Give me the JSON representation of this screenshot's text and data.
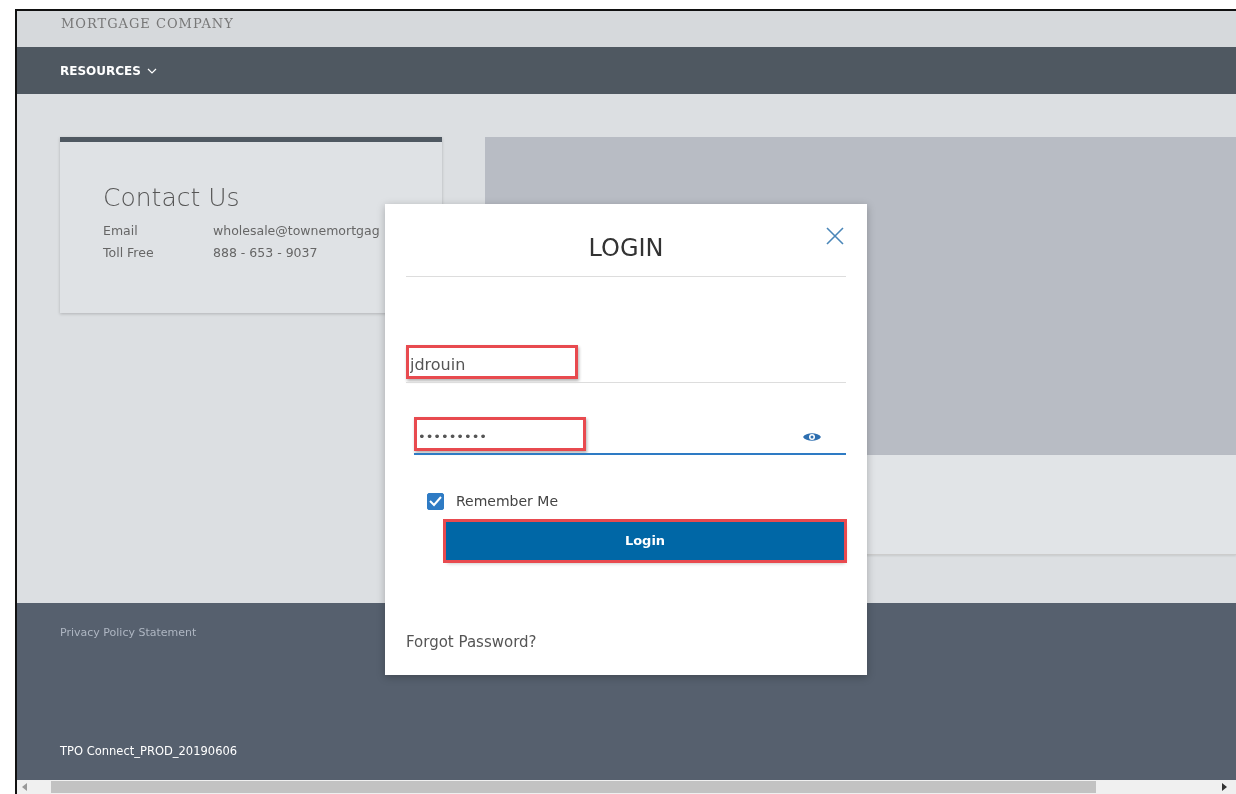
{
  "header": {
    "logo_text": "MORTGAGE COMPANY"
  },
  "nav": {
    "items": [
      {
        "label": "RESOURCES",
        "has_dropdown": true
      }
    ]
  },
  "contact": {
    "title": "Contact Us",
    "rows": [
      {
        "label": "Email",
        "value": "wholesale@townemortgag"
      },
      {
        "label": "Toll Free",
        "value": "888 - 653 - 9037"
      }
    ]
  },
  "footer": {
    "link": "Privacy Policy Statement",
    "version": "TPO Connect_PROD_20190606"
  },
  "modal": {
    "title": "LOGIN",
    "username": {
      "value": "jdrouin",
      "highlighted": true
    },
    "password": {
      "value": "•••••••••",
      "focused": true,
      "highlighted": true
    },
    "remember": {
      "label": "Remember Me",
      "checked": true
    },
    "login_button": {
      "label": "Login",
      "highlighted": true
    },
    "forgot_link": "Forgot Password?"
  }
}
